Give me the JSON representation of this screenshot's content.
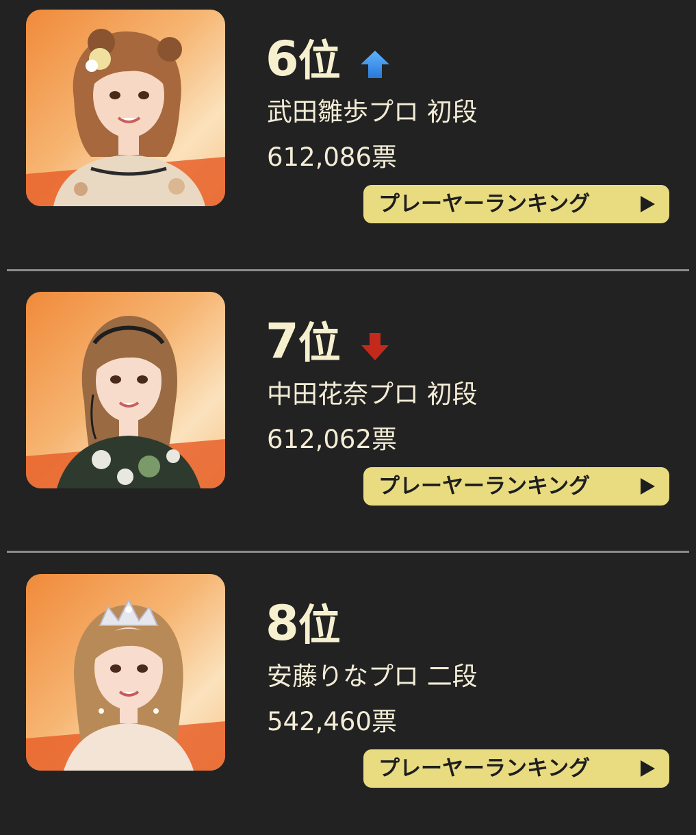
{
  "entries": [
    {
      "rank_number": "6",
      "rank_suffix": "位",
      "trend": "up",
      "trend_icon": "up-arrow-icon",
      "trend_color": "#3a8ee8",
      "name": "武田雛歩プロ 初段",
      "votes": "612,086票",
      "button_label": "プレーヤーランキング",
      "button_icon": "play-triangle-icon"
    },
    {
      "rank_number": "7",
      "rank_suffix": "位",
      "trend": "down",
      "trend_icon": "down-arrow-icon",
      "trend_color": "#c42a1c",
      "name": "中田花奈プロ 初段",
      "votes": "612,062票",
      "button_label": "プレーヤーランキング",
      "button_icon": "play-triangle-icon"
    },
    {
      "rank_number": "8",
      "rank_suffix": "位",
      "trend": "none",
      "name": "安藤りなプロ 二段",
      "votes": "542,460票",
      "button_label": "プレーヤーランキング",
      "button_icon": "play-triangle-icon"
    }
  ],
  "colors": {
    "background": "#222222",
    "button": "#e9dc80",
    "photo_accent": "#f08a3a",
    "text": "#f3ecd6"
  }
}
